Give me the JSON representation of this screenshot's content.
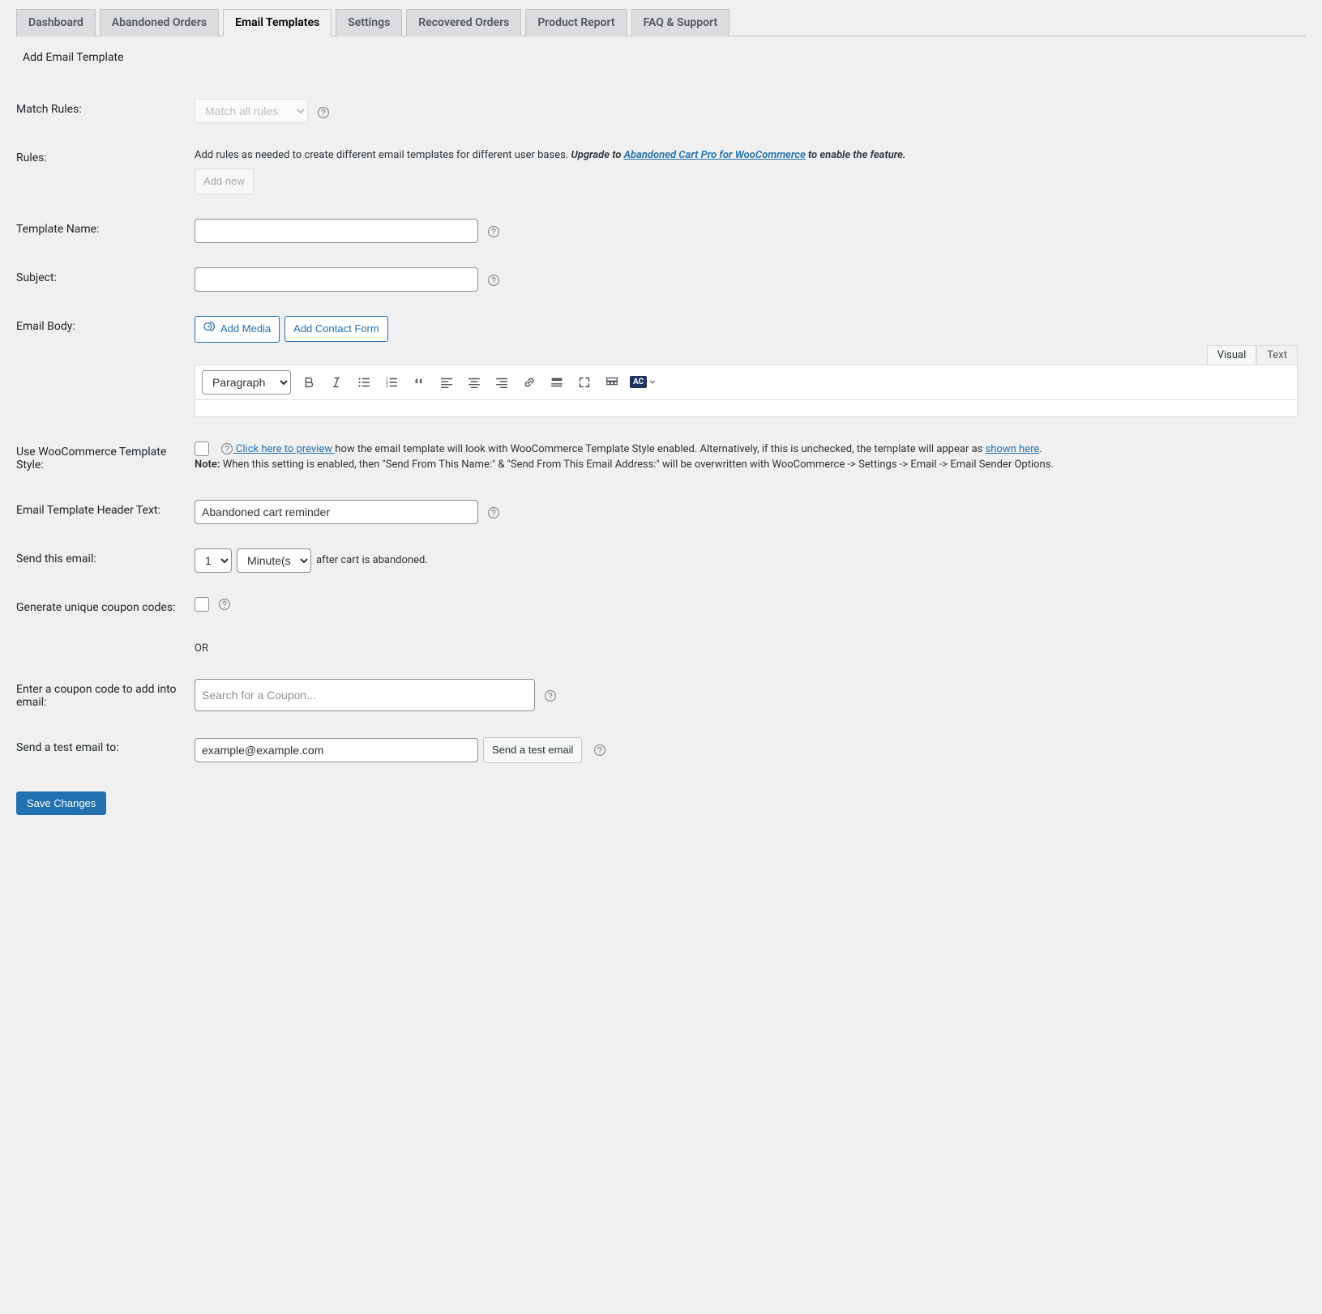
{
  "tabs": [
    {
      "label": "Dashboard"
    },
    {
      "label": "Abandoned Orders"
    },
    {
      "label": "Email Templates",
      "active": true
    },
    {
      "label": "Settings"
    },
    {
      "label": "Recovered Orders"
    },
    {
      "label": "Product Report"
    },
    {
      "label": "FAQ & Support"
    }
  ],
  "page_title": "Add Email Template",
  "labels": {
    "match_rules": "Match Rules:",
    "rules": "Rules:",
    "template_name": "Template Name:",
    "subject": "Subject:",
    "email_body": "Email Body:",
    "wc_template": "Use WooCommerce Template Style:",
    "header_text": "Email Template Header Text:",
    "send_this": "Send this email:",
    "coupon_codes": "Generate unique coupon codes:",
    "or": "OR",
    "enter_coupon": "Enter a coupon code to add into email:",
    "send_test": "Send a test email to:"
  },
  "match_rules": {
    "selected": "Match all rules"
  },
  "rules": {
    "desc_pre": "Add rules as needed to create different email templates for different user bases. ",
    "upgrade_pre": "Upgrade to ",
    "link_text": "Abandoned Cart Pro for WooCommerce",
    "upgrade_post": " to enable the feature.",
    "add_new": "Add new"
  },
  "editor": {
    "add_media": "Add Media",
    "add_contact": "Add Contact Form",
    "format_selected": "Paragraph",
    "visual_tab": "Visual",
    "text_tab": "Text",
    "ac_label": "AC"
  },
  "wc_style": {
    "preview_link_pre": " Click here to preview ",
    "preview_link_post_a": "how the email template will look with WooCommerce Template Style enabled. Alternatively, if this is unchecked, the template will appear as ",
    "shown_here": "shown here",
    "period": ".",
    "note_label": "Note:",
    "note_text": " When this setting is enabled, then \"Send From This Name:\" & \"Send From This Email Address:\" will be overwritten with WooCommerce -> Settings -> Email -> Email Sender Options."
  },
  "header_text_value": "Abandoned cart reminder",
  "send": {
    "number": "1",
    "unit": "Minute(s)",
    "after_text": "after cart is abandoned."
  },
  "coupon": {
    "search_placeholder": "Search for a Coupon..."
  },
  "test": {
    "email_value": "example@example.com",
    "button": "Send a test email"
  },
  "save_button": "Save Changes"
}
